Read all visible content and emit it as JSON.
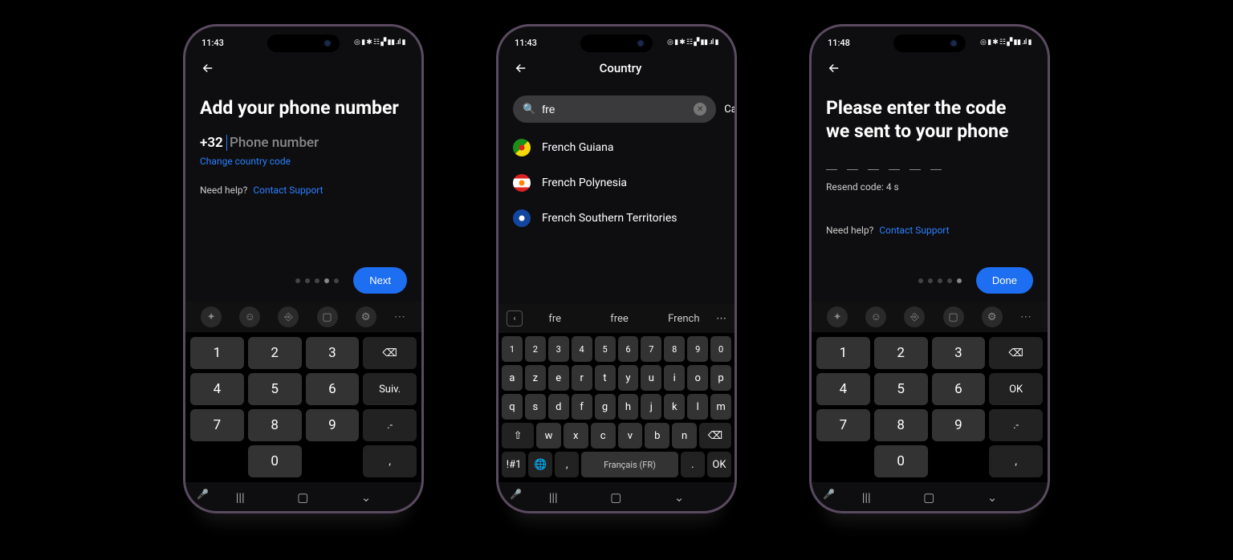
{
  "phone1": {
    "status_time": "11:43",
    "title": "Add your phone number",
    "country_code": "+32",
    "phone_placeholder": "Phone number",
    "change_link": "Change country code",
    "help_prefix": "Need help?",
    "contact_link": "Contact Support",
    "next_btn": "Next",
    "pager_active": 3,
    "numpad": {
      "keys": [
        [
          "1",
          "2",
          "3",
          "⌫"
        ],
        [
          "4",
          "5",
          "6",
          "Suiv."
        ],
        [
          "7",
          "8",
          "9",
          ".-"
        ],
        [
          "",
          "0",
          "",
          ","
        ]
      ]
    }
  },
  "phone2": {
    "status_time": "11:43",
    "header": "Country",
    "search_value": "fre",
    "cancel": "Cancel",
    "results": [
      {
        "name": "French Guiana",
        "flag_bg": "linear-gradient(135deg,#1a8f1a 50%,#f5d90a 50%)",
        "flag_dot": "#d22"
      },
      {
        "name": "French Polynesia",
        "flag_bg": "linear-gradient(#d22 25%,#fff 25% 75%,#d22 75%)",
        "flag_dot": "#f80"
      },
      {
        "name": "French Southern Territories",
        "flag_bg": "#1346a0",
        "flag_dot": "#fff"
      }
    ],
    "suggestions": [
      "fre",
      "free",
      "French"
    ],
    "azerty": {
      "row_num": [
        "1",
        "2",
        "3",
        "4",
        "5",
        "6",
        "7",
        "8",
        "9",
        "0"
      ],
      "row1": [
        "a",
        "z",
        "e",
        "r",
        "t",
        "y",
        "u",
        "i",
        "o",
        "p"
      ],
      "row2": [
        "q",
        "s",
        "d",
        "f",
        "g",
        "h",
        "j",
        "k",
        "l",
        "m"
      ],
      "row3": [
        "⇧",
        "w",
        "x",
        "c",
        "v",
        "b",
        "n",
        "⌫"
      ],
      "row4": [
        "!#1",
        "🌐",
        ",",
        "Français (FR)",
        ".",
        "OK"
      ]
    }
  },
  "phone3": {
    "status_time": "11:48",
    "title": "Please enter the code we sent to your phone",
    "resend": "Resend code: 4 s",
    "help_prefix": "Need help?",
    "contact_link": "Contact Support",
    "done_btn": "Done",
    "pager_active": 4,
    "numpad": {
      "keys": [
        [
          "1",
          "2",
          "3",
          "⌫"
        ],
        [
          "4",
          "5",
          "6",
          "OK"
        ],
        [
          "7",
          "8",
          "9",
          ".-"
        ],
        [
          "",
          "0",
          "",
          ","
        ]
      ]
    }
  }
}
